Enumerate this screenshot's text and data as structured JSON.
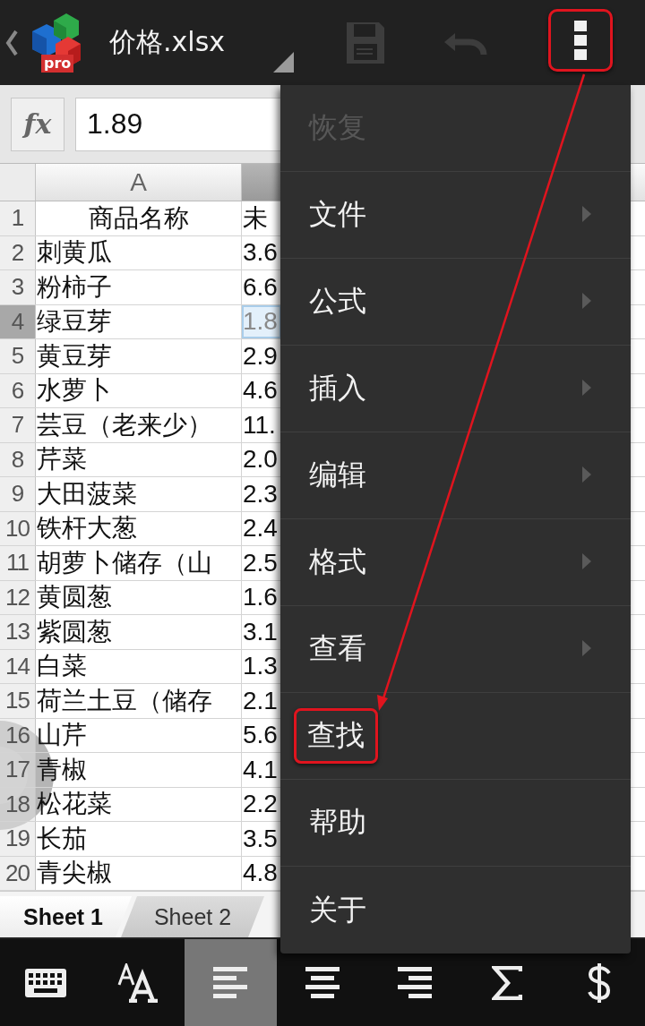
{
  "app_bar": {
    "logo_badge": "pro",
    "title": "价格.xlsx",
    "actions": [
      {
        "kind": "save",
        "disabled": true,
        "annotated": false
      },
      {
        "kind": "undo",
        "disabled": true,
        "annotated": false
      },
      {
        "kind": "overflow",
        "disabled": false,
        "annotated": true
      }
    ]
  },
  "formula_bar": {
    "label": "fx",
    "value": "1.89"
  },
  "sheet": {
    "columns": [
      {
        "label": "A",
        "selected": false
      },
      {
        "selected": true
      }
    ],
    "rows": [
      {
        "number": "1",
        "selected": false,
        "cells": [
          "商品名称",
          "未"
        ]
      },
      {
        "number": "2",
        "selected": false,
        "cells": [
          "刺黄瓜",
          "3.6"
        ]
      },
      {
        "number": "3",
        "selected": false,
        "cells": [
          "粉柿子",
          "6.6"
        ]
      },
      {
        "number": "4",
        "selected": true,
        "cells": [
          "绿豆芽",
          "1.8"
        ]
      },
      {
        "number": "5",
        "selected": false,
        "cells": [
          "黄豆芽",
          "2.9"
        ]
      },
      {
        "number": "6",
        "selected": false,
        "cells": [
          "水萝卜",
          "4.6"
        ]
      },
      {
        "number": "7",
        "selected": false,
        "cells": [
          "芸豆（老来少）",
          "11."
        ]
      },
      {
        "number": "8",
        "selected": false,
        "cells": [
          "芹菜",
          "2.0"
        ]
      },
      {
        "number": "9",
        "selected": false,
        "cells": [
          "大田菠菜",
          "2.3"
        ]
      },
      {
        "number": "10",
        "selected": false,
        "cells": [
          "铁杆大葱",
          "2.4"
        ]
      },
      {
        "number": "11",
        "selected": false,
        "cells": [
          "胡萝卜储存（山",
          "2.5"
        ]
      },
      {
        "number": "12",
        "selected": false,
        "cells": [
          "黄圆葱",
          "1.6"
        ]
      },
      {
        "number": "13",
        "selected": false,
        "cells": [
          "紫圆葱",
          "3.1"
        ]
      },
      {
        "number": "14",
        "selected": false,
        "cells": [
          "白菜",
          "1.3"
        ]
      },
      {
        "number": "15",
        "selected": false,
        "cells": [
          "荷兰土豆（储存",
          "2.1"
        ]
      },
      {
        "number": "16",
        "selected": false,
        "cells": [
          "山芹",
          "5.6"
        ]
      },
      {
        "number": "17",
        "selected": false,
        "cells": [
          "青椒",
          "4.1"
        ]
      },
      {
        "number": "18",
        "selected": false,
        "cells": [
          "松花菜",
          "2.2"
        ]
      },
      {
        "number": "19",
        "selected": false,
        "cells": [
          "长茄",
          "3.5"
        ]
      },
      {
        "number": "20",
        "selected": false,
        "cells": [
          "青尖椒",
          "4.8"
        ]
      }
    ]
  },
  "sheet_tabs": [
    {
      "label": "Sheet 1",
      "selected": true
    },
    {
      "label": "Sheet 2",
      "selected": false
    }
  ],
  "menu": {
    "items": [
      {
        "label": "恢复",
        "disabled": true,
        "submenu": false,
        "annotated": false
      },
      {
        "label": "文件",
        "disabled": false,
        "submenu": true,
        "annotated": false
      },
      {
        "label": "公式",
        "disabled": false,
        "submenu": true,
        "annotated": false
      },
      {
        "label": "插入",
        "disabled": false,
        "submenu": true,
        "annotated": false
      },
      {
        "label": "编辑",
        "disabled": false,
        "submenu": true,
        "annotated": false
      },
      {
        "label": "格式",
        "disabled": false,
        "submenu": true,
        "annotated": false
      },
      {
        "label": "查看",
        "disabled": false,
        "submenu": true,
        "annotated": false
      },
      {
        "label": "查找",
        "disabled": false,
        "submenu": false,
        "annotated": true
      },
      {
        "label": "帮助",
        "disabled": false,
        "submenu": false,
        "annotated": false
      },
      {
        "label": "关于",
        "disabled": false,
        "submenu": false,
        "annotated": false
      }
    ]
  },
  "toolbar": [
    {
      "kind": "keyboard",
      "selected": false
    },
    {
      "kind": "font-size",
      "selected": false
    },
    {
      "kind": "align-left",
      "selected": true
    },
    {
      "kind": "align-center",
      "selected": false
    },
    {
      "kind": "align-right",
      "selected": false
    },
    {
      "kind": "sum",
      "selected": false
    },
    {
      "kind": "currency",
      "selected": false
    }
  ]
}
